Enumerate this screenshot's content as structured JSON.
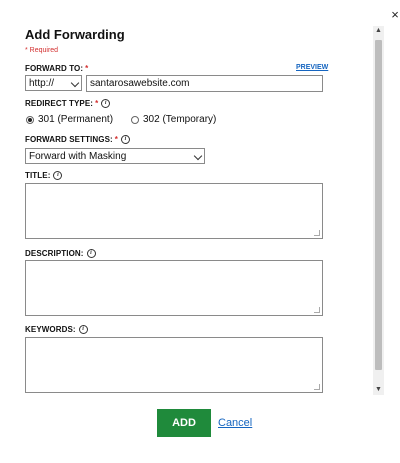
{
  "dialog": {
    "title": "Add Forwarding",
    "required_note": "* Required",
    "close_glyph": "×"
  },
  "forward_to": {
    "label": "FORWARD TO:",
    "required_mark": "*",
    "preview_link": "PREVIEW",
    "protocol_value": "http://",
    "url_value": "santarosawebsite.com"
  },
  "redirect_type": {
    "label": "REDIRECT TYPE:",
    "required_mark": "*",
    "options": [
      {
        "label": "301 (Permanent)",
        "selected": true
      },
      {
        "label": "302 (Temporary)",
        "selected": false
      }
    ]
  },
  "forward_settings": {
    "label": "FORWARD SETTINGS:",
    "required_mark": "*",
    "selected_value": "Forward with Masking"
  },
  "title_field": {
    "label": "TITLE:",
    "value": ""
  },
  "description_field": {
    "label": "DESCRIPTION:",
    "value": ""
  },
  "keywords_field": {
    "label": "KEYWORDS:",
    "value": ""
  },
  "actions": {
    "add_label": "ADD",
    "cancel_label": "Cancel"
  },
  "icons": {
    "info": "info-icon",
    "info_glyph": "i",
    "close": "close-icon",
    "scroll_up_glyph": "▲",
    "scroll_down_glyph": "▼"
  },
  "colors": {
    "required_red": "#d32f2f",
    "link_blue": "#1565c0",
    "add_button_green": "#1f8a3b"
  }
}
